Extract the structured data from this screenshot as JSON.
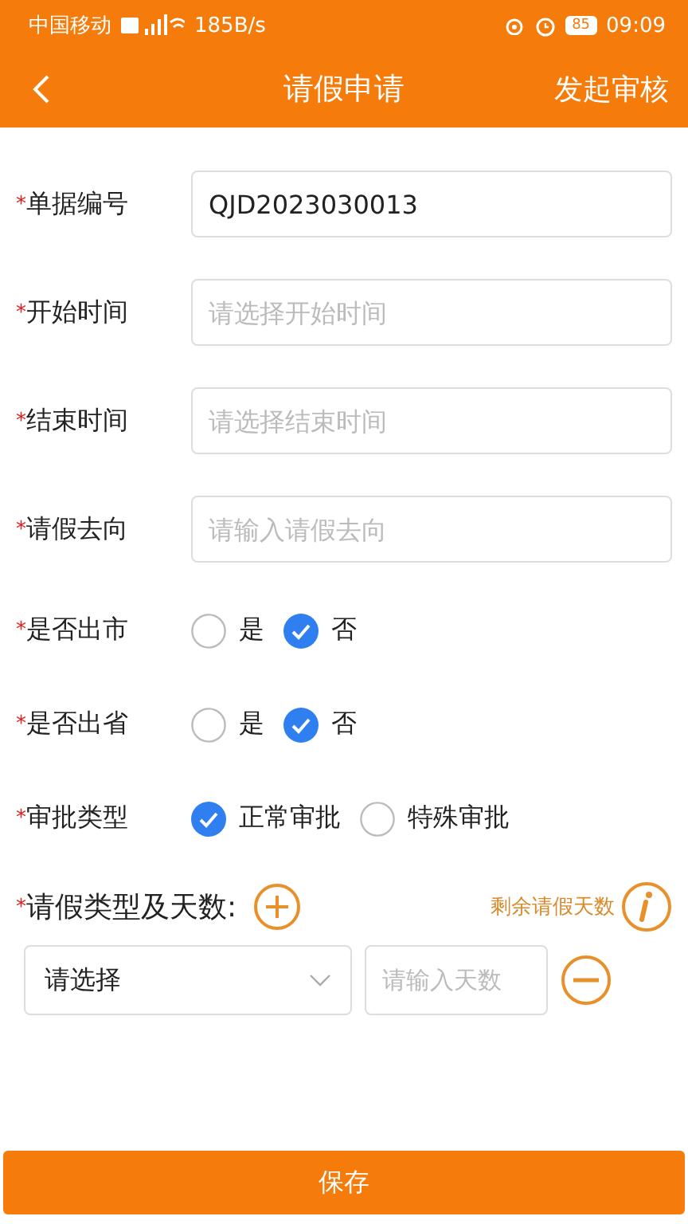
{
  "status_bar": {
    "carrier": "中国移动",
    "speed": "185B/s",
    "battery": "85",
    "time": "09:09"
  },
  "header": {
    "title": "请假申请",
    "action": "发起审核"
  },
  "fields": [
    {
      "kind": "text",
      "required_mark": "*",
      "label": "单据编号",
      "value": "QJD2023030013"
    },
    {
      "kind": "text",
      "required_mark": "*",
      "label": "开始时间",
      "placeholder": "请选择开始时间"
    },
    {
      "kind": "text",
      "required_mark": "*",
      "label": "结束时间",
      "placeholder": "请选择结束时间"
    },
    {
      "kind": "text",
      "required_mark": "*",
      "label": "请假去向",
      "placeholder": "请输入请假去向"
    },
    {
      "kind": "radio",
      "required_mark": "*",
      "label": "是否出市",
      "options": [
        {
          "label": "是",
          "selected": false
        },
        {
          "label": "否",
          "selected": true
        }
      ]
    },
    {
      "kind": "radio",
      "required_mark": "*",
      "label": "是否出省",
      "options": [
        {
          "label": "是",
          "selected": false
        },
        {
          "label": "否",
          "selected": true
        }
      ]
    },
    {
      "kind": "radio",
      "required_mark": "*",
      "label": "审批类型",
      "options": [
        {
          "label": "正常审批",
          "selected": true
        },
        {
          "label": "特殊审批",
          "selected": false
        }
      ]
    }
  ],
  "leave_types": {
    "required_mark": "*",
    "label": "请假类型及天数:",
    "info_label": "剩余请假天数",
    "rows": [
      {
        "select_value": "请选择",
        "days_placeholder": "请输入天数"
      }
    ]
  },
  "save_button": "保存"
}
